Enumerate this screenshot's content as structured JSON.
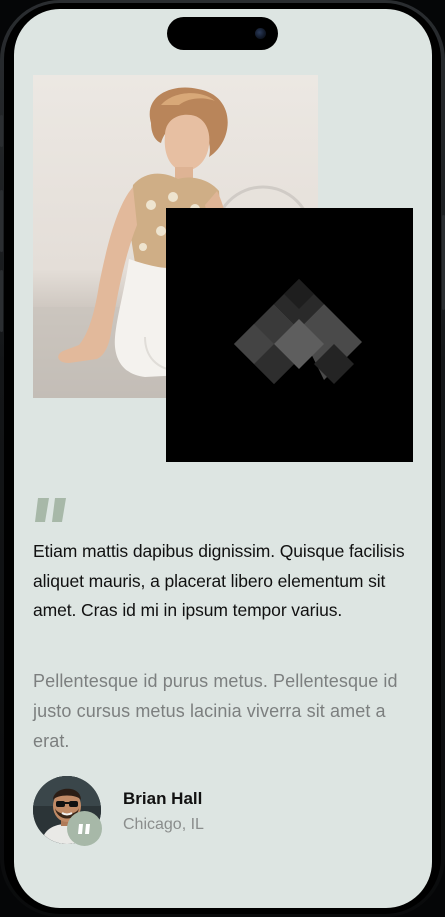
{
  "testimonial": {
    "quote": "Etiam mattis dapibus dignissim. Quisque facilisis aliquet mauris, a placerat libero elementum sit amet. Cras id mi in ipsum tempor varius.",
    "body": "Pellentesque id purus metus. Pellentesque id justo cursus metus lacinia viverra sit amet a erat.",
    "author": {
      "name": "Brian Hall",
      "location": "Chicago, IL"
    }
  },
  "colors": {
    "screen_background": "#dde5e2",
    "accent_green": "#a7b8a8",
    "quote_text": "#111111",
    "body_text": "#7c7f7f",
    "logo_card": "#000000"
  },
  "icons": {
    "quote": "quote-icon",
    "badge": "quote-badge-icon",
    "logo": "diamond-logo-mark"
  }
}
